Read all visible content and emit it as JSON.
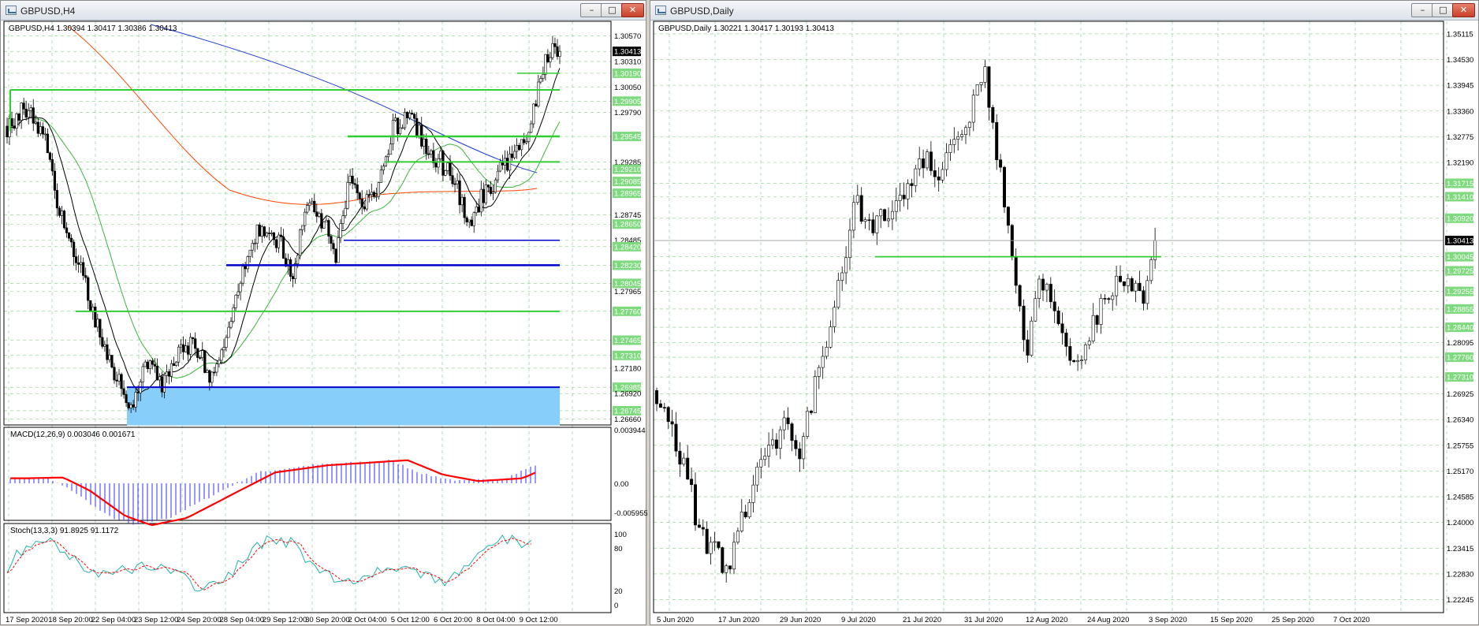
{
  "windows": [
    {
      "id": "h4",
      "title": "GBPUSD,H4",
      "header": "GBPUSD,H4  1.30394 1.30417 1.30386 1.30413",
      "price_scale": [
        "1.30570",
        "1.30413",
        "1.30310",
        "1.30190",
        "1.30050",
        "1.29905",
        "1.29790",
        "1.29545",
        "1.29285",
        "1.29210",
        "1.29085",
        "1.28965",
        "1.28745",
        "1.28650",
        "1.28485",
        "1.28420",
        "1.28230",
        "1.28045",
        "1.27965",
        "1.27760",
        "1.27465",
        "1.27310",
        "1.27180",
        "1.26985",
        "1.26920",
        "1.26745",
        "1.26660"
      ],
      "current_price": "1.30413",
      "macd_label": "MACD(12,26,9) 0.003046 0.001671",
      "macd_scale": [
        "0.003944",
        "0.00",
        "-0.005955"
      ],
      "stoch_label": "Stoch(13,3,3) 91.8925 91.1172",
      "stoch_scale": [
        "100",
        "80",
        "20",
        "0"
      ],
      "time_axis": [
        "17 Sep 2020",
        "18 Sep 20:00",
        "22 Sep 04:00",
        "23 Sep 12:00",
        "24 Sep 20:00",
        "28 Sep 04:00",
        "29 Sep 12:00",
        "30 Sep 20:00",
        "2 Oct 04:00",
        "5 Oct 12:00",
        "6 Oct 20:00",
        "8 Oct 04:00",
        "9 Oct 12:00"
      ]
    },
    {
      "id": "daily",
      "title": "GBPUSD,Daily",
      "header": "GBPUSD,Daily  1.30221 1.30417 1.30193 1.30413",
      "price_scale": [
        "1.35115",
        "1.34530",
        "1.33945",
        "1.33360",
        "1.32775",
        "1.32190",
        "1.31715",
        "1.31410",
        "1.30920",
        "1.30413",
        "1.30045",
        "1.29725",
        "1.28855",
        "1.29255",
        "1.28440",
        "1.28095",
        "1.27760",
        "1.27310",
        "1.26925",
        "1.26340",
        "1.25755",
        "1.25170",
        "1.24585",
        "1.24000",
        "1.23415",
        "1.22830",
        "1.22245"
      ],
      "current_price": "1.30413",
      "time_axis": [
        "5 Jun 2020",
        "17 Jun 2020",
        "29 Jun 2020",
        "9 Jul 2020",
        "21 Jul 2020",
        "31 Jul 2020",
        "12 Aug 2020",
        "24 Aug 2020",
        "3 Sep 2020",
        "15 Sep 2020",
        "25 Sep 2020",
        "7 Oct 2020"
      ]
    }
  ],
  "buttons": {
    "minimize": "–",
    "maximize": "□",
    "close": "✕"
  },
  "colors": {
    "bull": "#ffffff",
    "bear": "#000000",
    "support_zone": "#87cefa",
    "green_line": "#32cd32",
    "blue_line": "#0000cd",
    "ma_blue": "#1f3fd6",
    "ma_red": "#ff4500",
    "ma_green": "#3cb43c",
    "macd_hist": "#3030ff",
    "macd_signal": "#ff0000",
    "stoch_main": "#20b2aa",
    "stoch_signal": "#ff0000"
  }
}
